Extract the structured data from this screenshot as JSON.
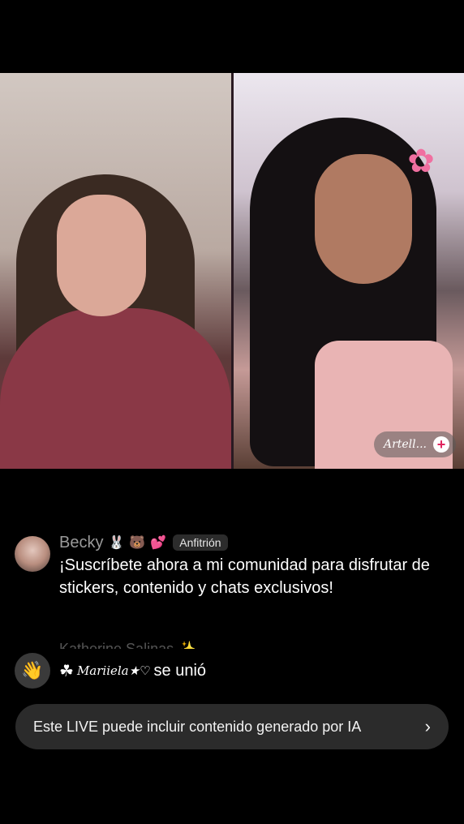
{
  "stream": {
    "guest_tag": "Artell...",
    "plus_symbol": "+"
  },
  "comment": {
    "username": "Becky",
    "emojis": [
      "🐰",
      "🐻",
      "💕"
    ],
    "role_badge": "Anfitrión",
    "message": "¡Suscríbete ahora a mi comunidad para disfrutar de stickers, contenido y chats exclusivos!"
  },
  "faded_comment": {
    "username": "Katherine Salinas ✨"
  },
  "join": {
    "prefix": "☘",
    "user": "Mariiela★♡",
    "action": "se unió"
  },
  "ai_banner": {
    "text": "Este LIVE puede incluir contenido generado por IA",
    "chevron": "›"
  },
  "colors": {
    "background": "#000000",
    "banner": "#2b2b2b",
    "host_badge": "#2c2c2c",
    "plus_accent": "#e0245e"
  }
}
